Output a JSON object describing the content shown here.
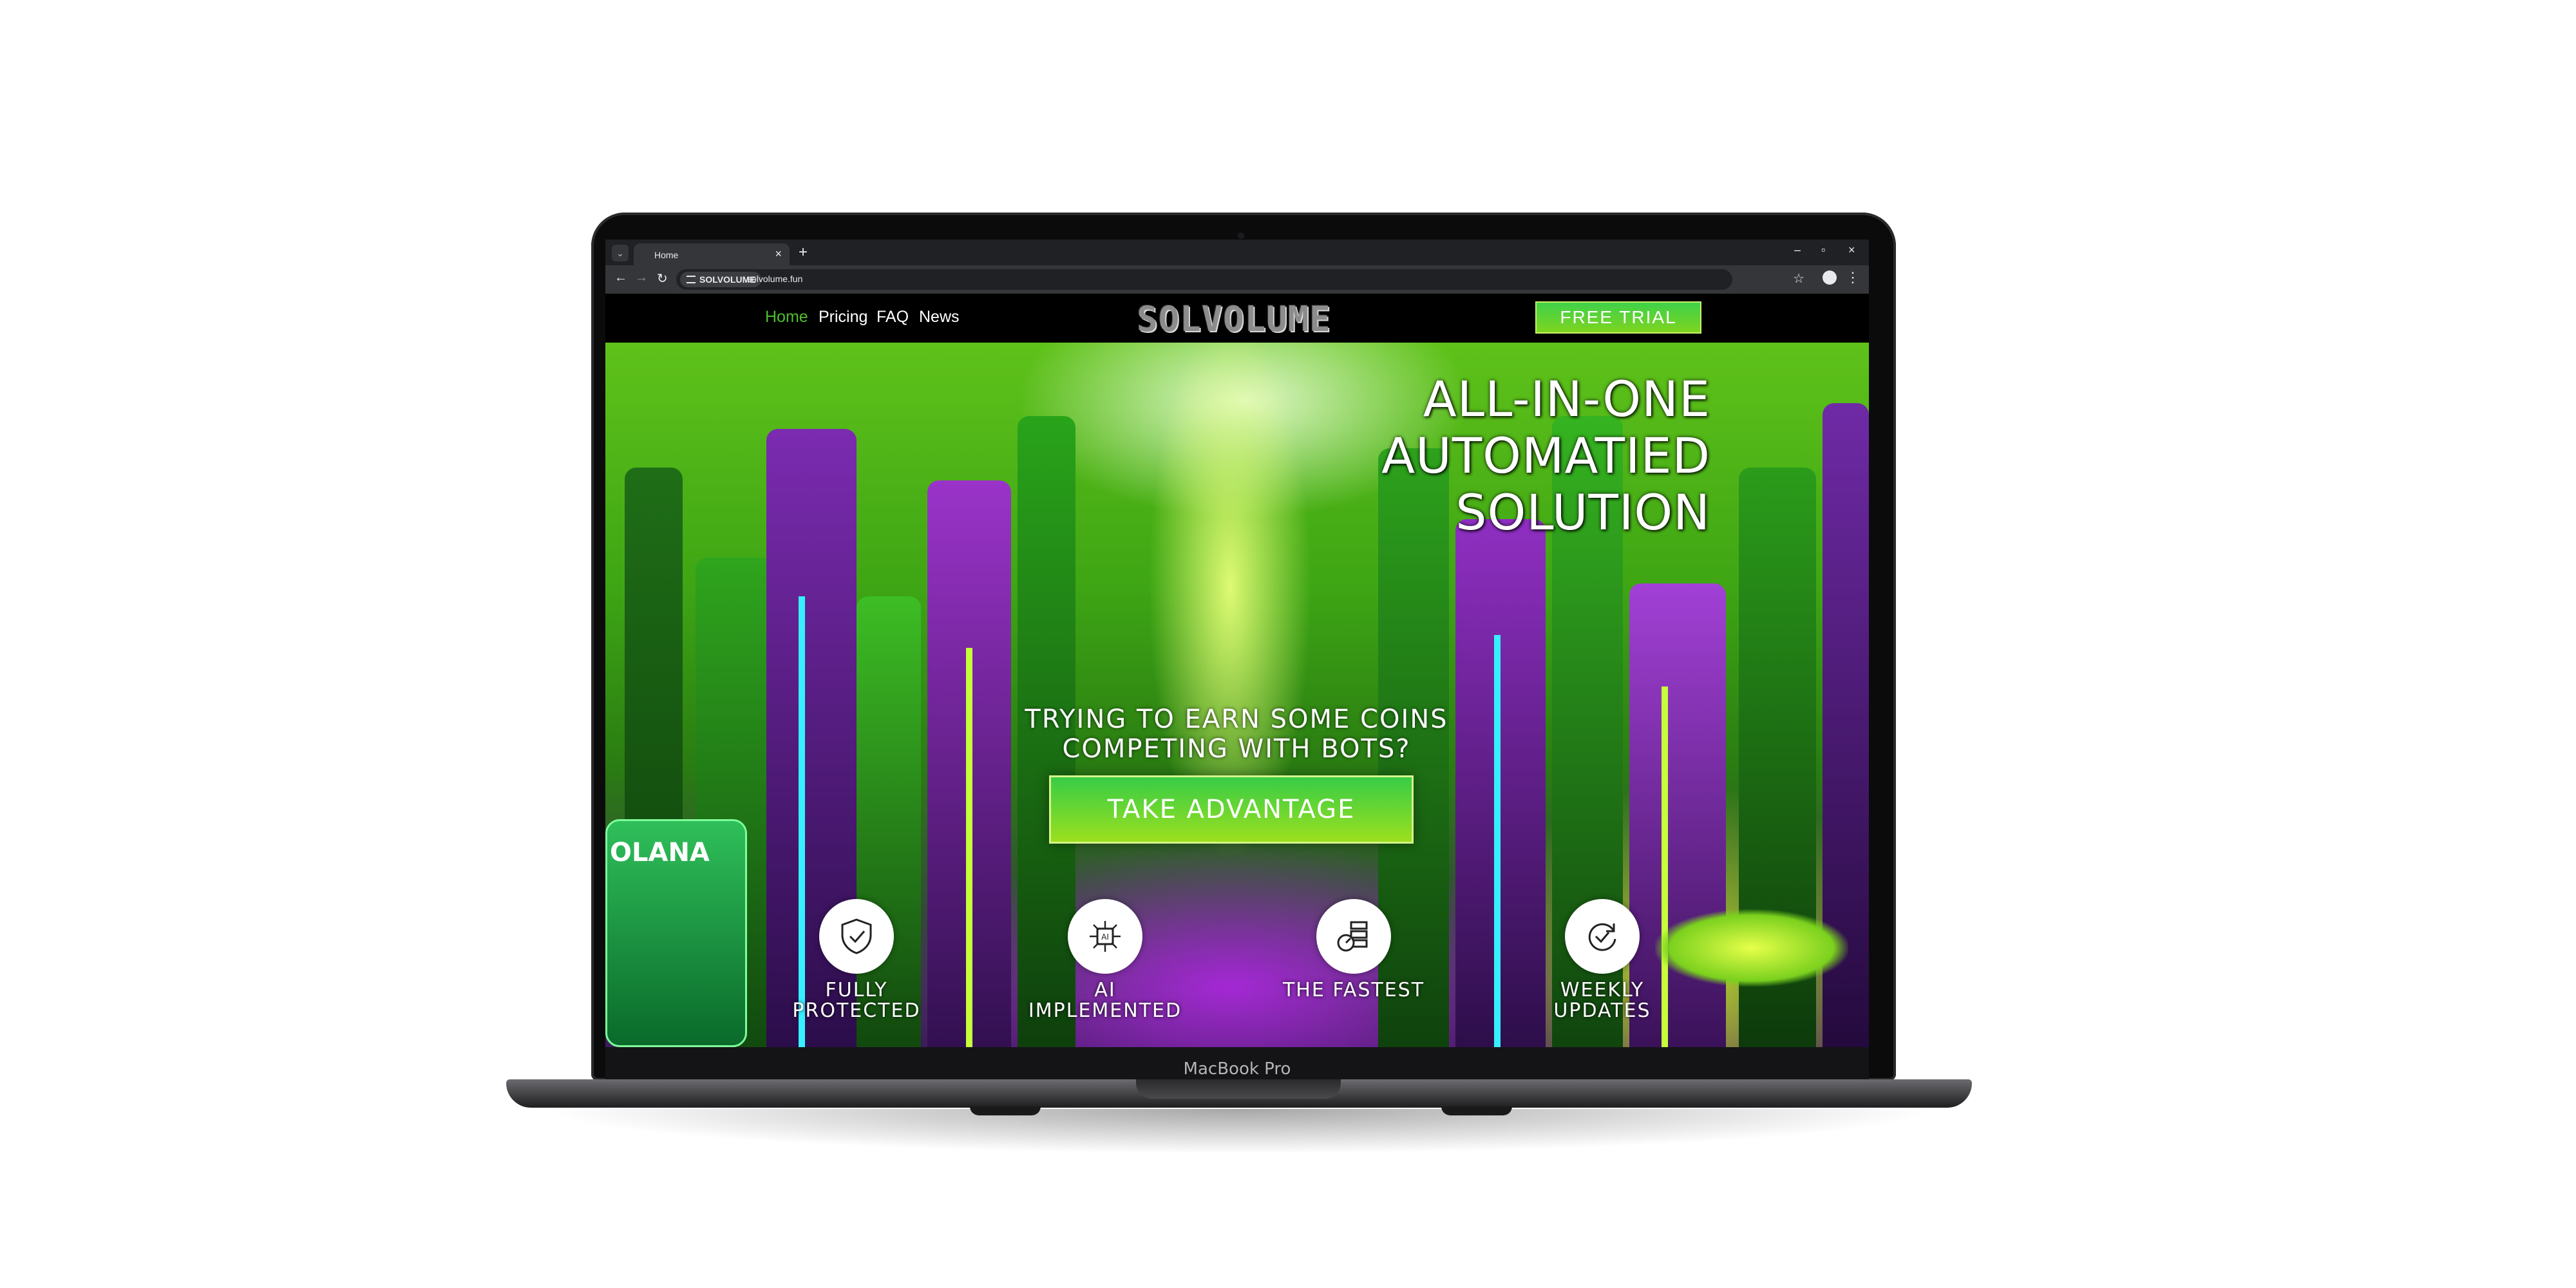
{
  "device": {
    "chin_label": "MacBook Pro"
  },
  "browser": {
    "tab_title": "Home",
    "site_chip": "SOLVOLUME",
    "url": "solvolume.fun",
    "new_tab": "+",
    "tab_close": "×",
    "win_min": "–",
    "win_max": "▫",
    "win_close": "×",
    "back": "←",
    "forward": "→",
    "reload": "↻",
    "star": "☆",
    "menu": "⋮",
    "tab_dropdown": "⌄"
  },
  "header": {
    "nav": [
      "Home",
      "Pricing",
      "FAQ",
      "News"
    ],
    "logo": "SOLVOLUME",
    "trial_button": "FREE TRIAL",
    "colors": {
      "active_nav": "#4fbf2e",
      "button": "#5fd12f"
    }
  },
  "hero": {
    "title_lines": [
      "ALL-IN-ONE",
      "AUTOMATIED",
      "SOLUTION"
    ],
    "subtitle_lines": [
      "TRYING TO EARN SOME COINS",
      "COMPETING WITH BOTS?"
    ],
    "cta": "TAKE ADVANTAGE",
    "sign_text": "OLANA"
  },
  "features": [
    {
      "icon": "shield-check-icon",
      "label_lines": [
        "FULLY",
        "PROTECTED"
      ]
    },
    {
      "icon": "ai-chip-icon",
      "label_lines": [
        "AI",
        "IMPLEMENTED"
      ]
    },
    {
      "icon": "speed-server-icon",
      "label_lines": [
        "THE FASTEST",
        ""
      ]
    },
    {
      "icon": "update-cycle-icon",
      "label_lines": [
        "WEEKLY",
        "UPDATES"
      ]
    }
  ]
}
